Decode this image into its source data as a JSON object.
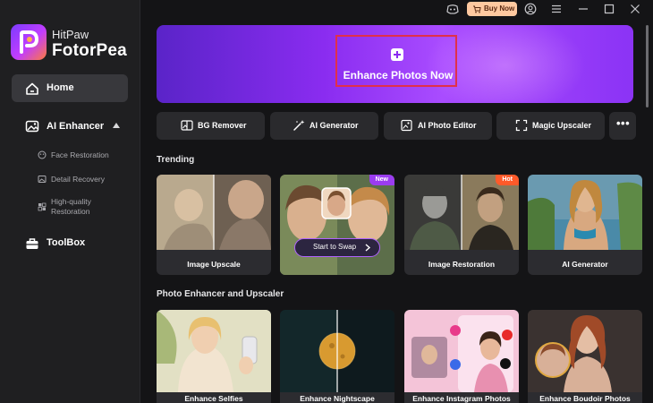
{
  "app": {
    "brand_small": "HitPaw",
    "brand_big": "FotorPea"
  },
  "titlebar": {
    "buy_label": "Buy Now",
    "icons": [
      "discord-icon",
      "cart-icon",
      "user-icon",
      "menu-icon",
      "minimize-icon",
      "maximize-icon",
      "close-icon"
    ]
  },
  "sidebar": {
    "home": "Home",
    "ai_enhancer": "AI Enhancer",
    "sub_items": [
      "Face Restoration",
      "Detail Recovery",
      "High-quality",
      "Restoration"
    ],
    "toolbox": "ToolBox"
  },
  "hero": {
    "label": "Enhance Photos Now"
  },
  "tools": [
    {
      "label": "BG Remover",
      "icon": "bg-remover-icon"
    },
    {
      "label": "AI Generator",
      "icon": "wand-icon"
    },
    {
      "label": "AI Photo Editor",
      "icon": "photo-edit-icon"
    },
    {
      "label": "Magic Upscaler",
      "icon": "upscale-icon"
    }
  ],
  "more_label": "•••",
  "trending": {
    "title": "Trending",
    "cards": [
      {
        "label": "Image Upscale"
      },
      {
        "label": "",
        "badge": "New",
        "button": "Start to Swap"
      },
      {
        "label": "Image Restoration",
        "badge": "Hot"
      },
      {
        "label": "AI Generator"
      }
    ]
  },
  "enhancer": {
    "title": "Photo Enhancer and Upscaler",
    "cards": [
      {
        "label": "Enhance Selfies"
      },
      {
        "label": "Enhance Nightscape"
      },
      {
        "label": "Enhance Instagram Photos"
      },
      {
        "label": "Enhance Boudoir Photos"
      }
    ]
  },
  "colors": {
    "accent_purple": "#8a2cf0",
    "highlight_red": "#e0304a",
    "badge_new": "#9b3cf0",
    "badge_hot": "#ff5a2a",
    "buy_bg": "#ffc9a0"
  }
}
